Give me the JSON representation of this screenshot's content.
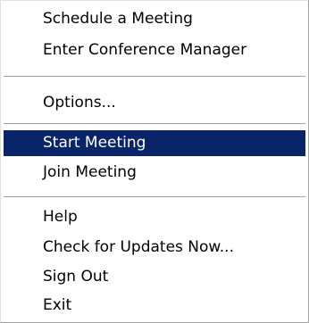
{
  "menu": {
    "items": [
      {
        "label": "Schedule a Meeting"
      },
      {
        "label": "Enter Conference Manager"
      },
      {
        "label": "Options..."
      },
      {
        "label": "Start Meeting"
      },
      {
        "label": "Join Meeting"
      },
      {
        "label": "Help"
      },
      {
        "label": "Check for Updates Now..."
      },
      {
        "label": "Sign Out"
      },
      {
        "label": "Exit"
      }
    ],
    "selected_index": 3
  },
  "colors": {
    "selection_background": "#0a246a",
    "selection_text": "#ffffff",
    "separator": "#a0a0a0"
  }
}
